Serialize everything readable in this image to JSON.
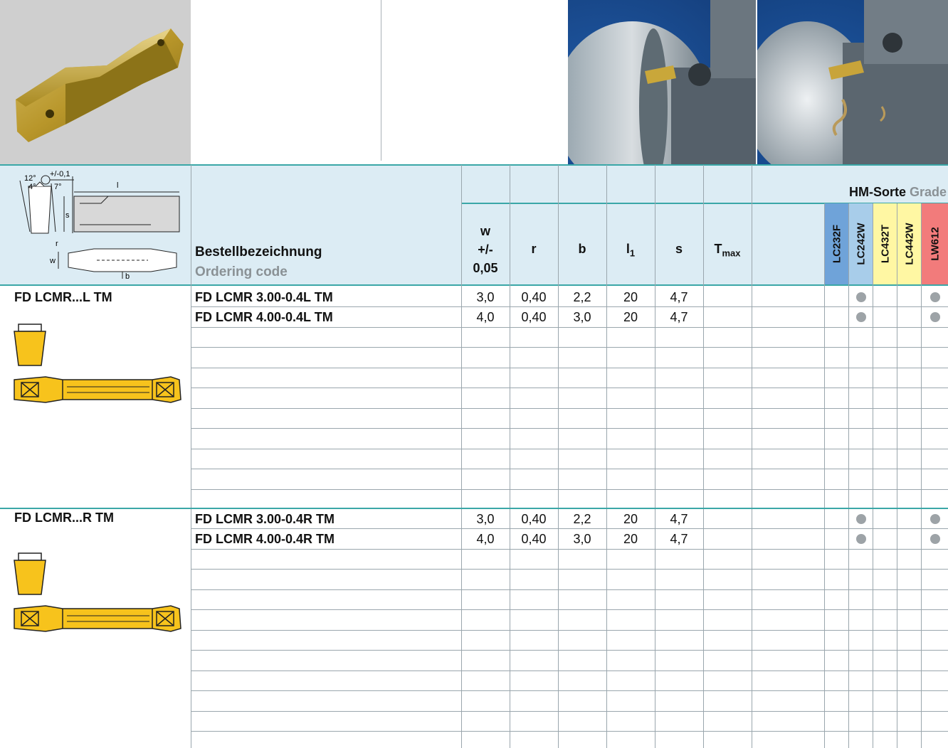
{
  "header": {
    "designation_de": "Bestellbezeichnung",
    "designation_en": "Ordering code",
    "grade_de": "HM-Sorte",
    "grade_en": "Grade",
    "w_lines": [
      "w",
      "+/-",
      "0,05"
    ],
    "col_r": "r",
    "col_b": "b",
    "col_l1": "l",
    "col_l1_sub": "1",
    "col_s": "s",
    "col_tmax": "T",
    "col_tmax_sub": "max"
  },
  "drawing_labels": {
    "angle_12": "12°",
    "angle_4": "4°",
    "angle_7": "7°",
    "tol": "+/-0,1",
    "l1": "l",
    "l1_sub": "1",
    "s": "s",
    "r": "r",
    "w": "w",
    "b": "b"
  },
  "grades": [
    {
      "name": "LC232F",
      "color": "#6fa3d9"
    },
    {
      "name": "LC242W",
      "color": "#a8cdea"
    },
    {
      "name": "LC432T",
      "color": "#fff7a3"
    },
    {
      "name": "LC442W",
      "color": "#fff7a3"
    },
    {
      "name": "LW612",
      "color": "#f27b7b"
    }
  ],
  "sections": [
    {
      "family": "FD LCMR...L TM",
      "rows": [
        {
          "code": "FD LCMR 3.00-0.4L TM",
          "w": "3,0",
          "r": "0,40",
          "b": "2,2",
          "l1": "20",
          "s": "4,7",
          "grades": [
            false,
            true,
            false,
            false,
            true
          ]
        },
        {
          "code": "FD LCMR 4.00-0.4L TM",
          "w": "4,0",
          "r": "0,40",
          "b": "3,0",
          "l1": "20",
          "s": "4,7",
          "grades": [
            false,
            true,
            false,
            false,
            true
          ]
        }
      ]
    },
    {
      "family": "FD LCMR...R TM",
      "rows": [
        {
          "code": "FD LCMR 3.00-0.4R TM",
          "w": "3,0",
          "r": "0,40",
          "b": "2,2",
          "l1": "20",
          "s": "4,7",
          "grades": [
            false,
            true,
            false,
            false,
            true
          ]
        },
        {
          "code": "FD LCMR 4.00-0.4R TM",
          "w": "4,0",
          "r": "0,40",
          "b": "3,0",
          "l1": "20",
          "s": "4,7",
          "grades": [
            false,
            true,
            false,
            false,
            true
          ]
        }
      ]
    }
  ]
}
